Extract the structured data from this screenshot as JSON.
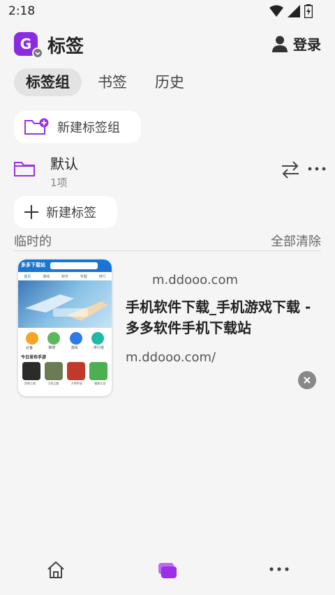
{
  "status": {
    "time": "2:18"
  },
  "header": {
    "badge_letter": "G",
    "title": "标签",
    "login_label": "登录"
  },
  "tabs": [
    {
      "label": "标签组",
      "active": true
    },
    {
      "label": "书签",
      "active": false
    },
    {
      "label": "历史",
      "active": false
    }
  ],
  "new_group_label": "新建标签组",
  "group": {
    "name": "默认",
    "count": "1项"
  },
  "new_tab_label": "新建标签",
  "section": {
    "title": "临时的",
    "clear_all": "全部清除"
  },
  "tab_card": {
    "domain": "m.ddooo.com",
    "title": "手机软件下载_手机游戏下载 - 多多软件手机下载站",
    "url": "m.ddooo.com/",
    "thumb": {
      "brand": "多多下载站",
      "nav": [
        "首页",
        "游戏",
        "软件",
        "专题",
        "排行"
      ],
      "icon_labels": [
        "必备",
        "推荐",
        "游戏",
        "排行榜"
      ],
      "section": "今日发布手游",
      "game_labels": [
        "剑侠江湖",
        "王权之路",
        "大明传说",
        "植物大战"
      ]
    }
  },
  "colors": {
    "accent": "#9b30e6",
    "badge": "#8a2be2"
  },
  "icons": [
    "wifi-icon",
    "signal-icon",
    "battery-icon",
    "person-icon",
    "folder-add-icon",
    "folder-icon",
    "swap-icon",
    "more-icon",
    "plus-icon",
    "close-icon",
    "home-icon",
    "tabs-icon"
  ]
}
